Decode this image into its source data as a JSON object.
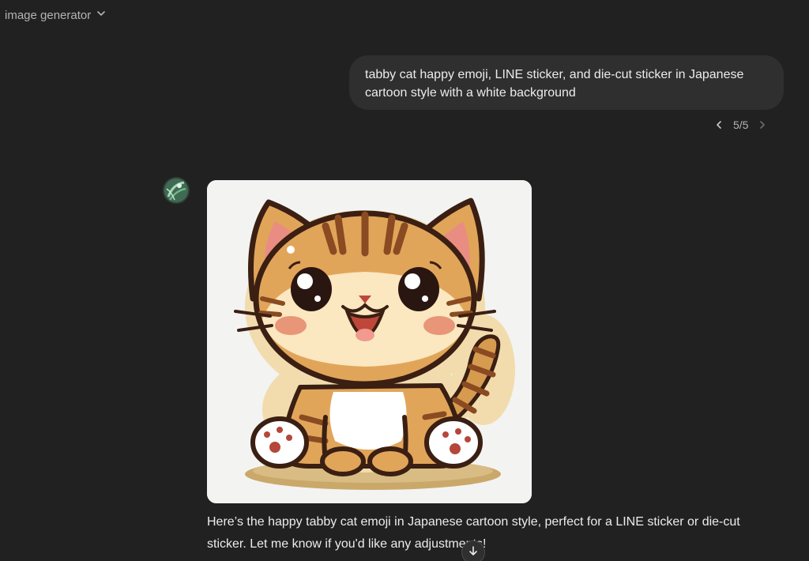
{
  "header": {
    "title": "image generator",
    "dropdown_icon": "chevron-down-icon"
  },
  "user_message": {
    "text": "tabby cat happy emoji, LINE sticker, and die-cut sticker in Japanese cartoon style with a white background"
  },
  "pager": {
    "label": "5/5",
    "prev_icon": "chevron-left-icon",
    "next_icon": "chevron-right-icon"
  },
  "assistant_message": {
    "avatar_icon": "assistant-avatar-icon",
    "image_subject": "cartoon tabby cat sticker",
    "text": "Here’s the happy tabby cat emoji in Japanese cartoon style, perfect for a LINE sticker or die-cut sticker. Let me know if you'd like any adjustments!"
  },
  "scroll_button": {
    "icon": "arrow-down-icon"
  },
  "colors": {
    "background": "#212121",
    "bubble": "#2f2f2f",
    "text": "#ececec",
    "muted": "#b4b4b4"
  }
}
